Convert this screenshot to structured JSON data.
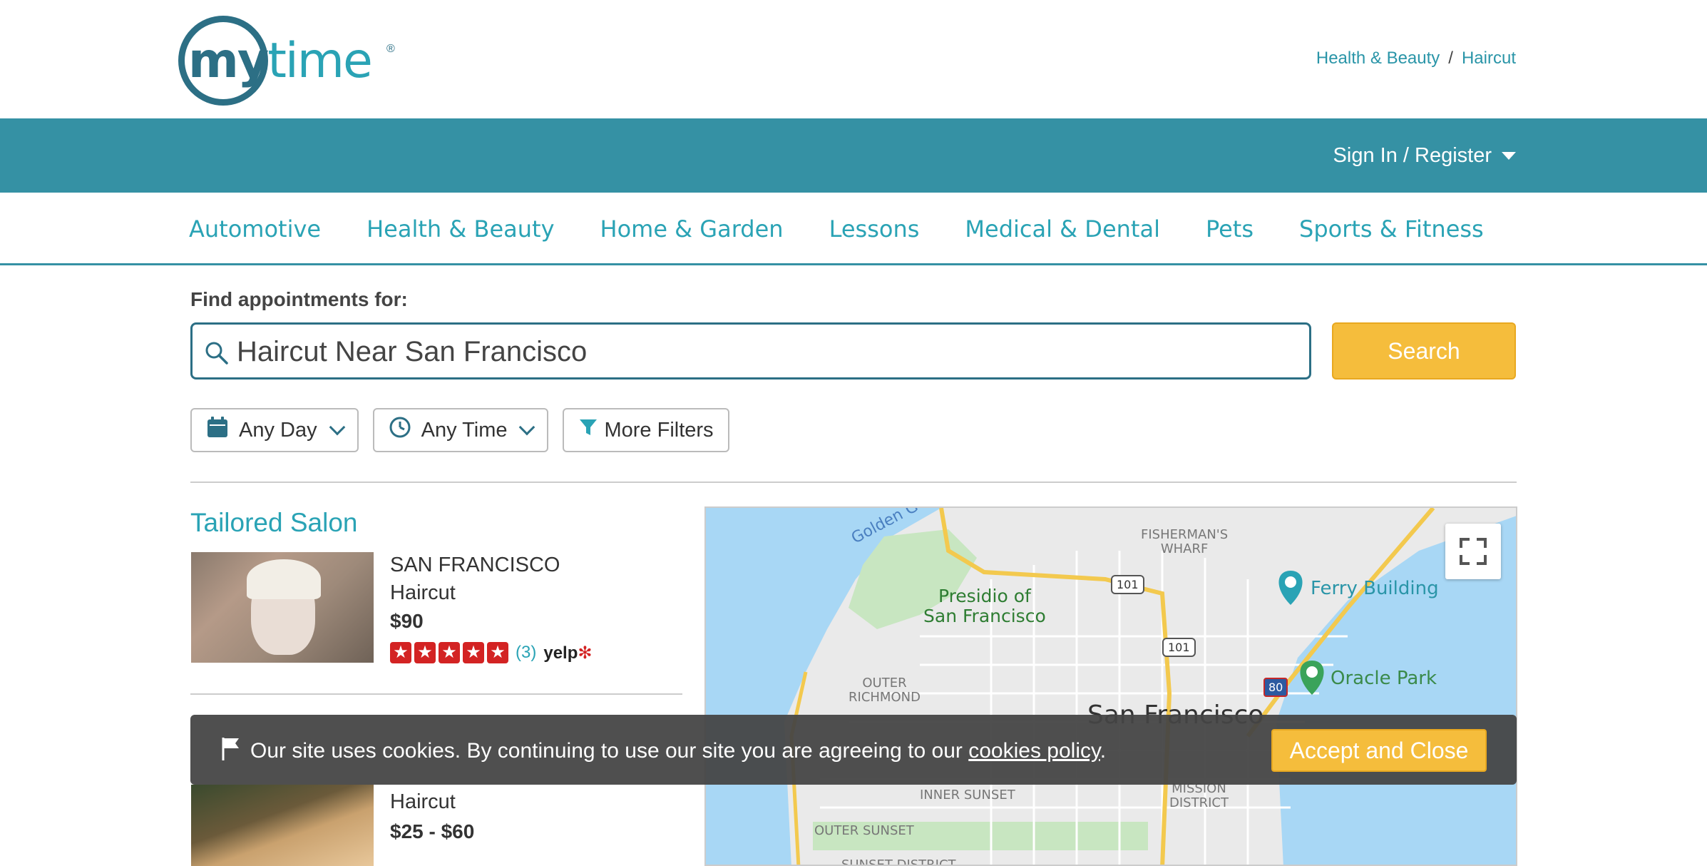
{
  "header": {
    "logo": {
      "my": "my",
      "time": "time",
      "reg": "®"
    },
    "breadcrumb": {
      "first": "Health & Beauty",
      "separator": "/",
      "second": "Haircut"
    }
  },
  "topbar": {
    "signin_label": "Sign In / Register"
  },
  "categories": [
    "Automotive",
    "Health & Beauty",
    "Home & Garden",
    "Lessons",
    "Medical & Dental",
    "Pets",
    "Sports & Fitness"
  ],
  "search": {
    "label": "Find appointments for:",
    "value": "Haircut Near San Francisco",
    "button_label": "Search"
  },
  "filters": {
    "day": "Any Day",
    "time": "Any Time",
    "more": "More Filters"
  },
  "results": [
    {
      "name": "Tailored Salon",
      "city": "SAN FRANCISCO",
      "service": "Haircut",
      "price": "$90",
      "rating": 5,
      "review_count": "(3)",
      "review_source": "yelp"
    },
    {
      "service": "Haircut",
      "price": "$25 - $60"
    }
  ],
  "map": {
    "labels": {
      "golden": "Golden G",
      "fishermans_1": "FISHERMAN'S",
      "fishermans_2": "WHARF",
      "presidio_1": "Presidio of",
      "presidio_2": "San Francisco",
      "ferry": "Ferry Building",
      "oracle": "Oracle Park",
      "outer_richmond_1": "OUTER",
      "outer_richmond_2": "RICHMOND",
      "sf": "San Francisco",
      "inner_sunset": "INNER SUNSET",
      "mission_1": "MISSION",
      "mission_2": "DISTRICT",
      "outer_sunset": "OUTER SUNSET",
      "sunset_district": "SUNSET DISTRICT",
      "hw101_a": "101",
      "hw101_b": "101",
      "hw101_c": "101",
      "i80": "80"
    }
  },
  "cookie": {
    "message_before": "Our site uses cookies. By continuing to use our site you are agreeing to our ",
    "link_text": "cookies policy",
    "message_after": ".",
    "accept_label": "Accept and Close"
  },
  "colors": {
    "brand_teal": "#3591a4",
    "link_teal": "#2aa3b5",
    "accent_yellow": "#f5bd3c",
    "logo_dark": "#2c6f85"
  }
}
